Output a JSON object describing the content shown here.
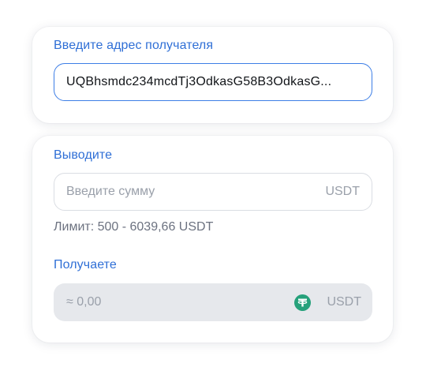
{
  "recipient": {
    "label": "Введите адрес получателя",
    "address_value": "UQBhsmdc234mcdTj3OdkasG58B3OdkasG..."
  },
  "withdraw": {
    "label": "Выводите",
    "amount_placeholder": "Введите сумму",
    "currency": "USDT",
    "limit_text": "Лимит: 500 - 6039,66 USDT"
  },
  "receive": {
    "label": "Получаете",
    "amount_value": "≈ 0,00",
    "currency": "USDT",
    "currency_icon": "usdt-tether-icon"
  },
  "colors": {
    "accent": "#2f6fd6",
    "focus_border": "#3d7ee6",
    "tether_green": "#26a17b"
  }
}
